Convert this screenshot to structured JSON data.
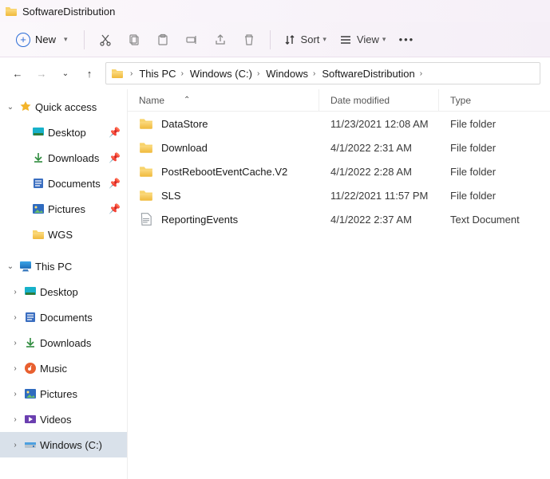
{
  "titlebar": {
    "title": "SoftwareDistribution"
  },
  "toolbar": {
    "new_label": "New",
    "sort_label": "Sort",
    "view_label": "View"
  },
  "breadcrumbs": {
    "0": {
      "label": "This PC"
    },
    "1": {
      "label": "Windows (C:)"
    },
    "2": {
      "label": "Windows"
    },
    "3": {
      "label": "SoftwareDistribution"
    }
  },
  "columns": {
    "name": "Name",
    "modified": "Date modified",
    "type": "Type"
  },
  "files": {
    "0": {
      "name": "DataStore",
      "modified": "11/23/2021 12:08 AM",
      "type": "File folder",
      "kind": "folder"
    },
    "1": {
      "name": "Download",
      "modified": "4/1/2022 2:31 AM",
      "type": "File folder",
      "kind": "folder"
    },
    "2": {
      "name": "PostRebootEventCache.V2",
      "modified": "4/1/2022 2:28 AM",
      "type": "File folder",
      "kind": "folder"
    },
    "3": {
      "name": "SLS",
      "modified": "11/22/2021 11:57 PM",
      "type": "File folder",
      "kind": "folder"
    },
    "4": {
      "name": "ReportingEvents",
      "modified": "4/1/2022 2:37 AM",
      "type": "Text Document",
      "kind": "text"
    }
  },
  "sidebar": {
    "quick_access": {
      "label": "Quick access"
    },
    "qa": {
      "0": {
        "label": "Desktop"
      },
      "1": {
        "label": "Downloads"
      },
      "2": {
        "label": "Documents"
      },
      "3": {
        "label": "Pictures"
      },
      "4": {
        "label": "WGS"
      }
    },
    "this_pc": {
      "label": "This PC"
    },
    "pc": {
      "0": {
        "label": "Desktop"
      },
      "1": {
        "label": "Documents"
      },
      "2": {
        "label": "Downloads"
      },
      "3": {
        "label": "Music"
      },
      "4": {
        "label": "Pictures"
      },
      "5": {
        "label": "Videos"
      },
      "6": {
        "label": "Windows (C:)"
      }
    }
  }
}
